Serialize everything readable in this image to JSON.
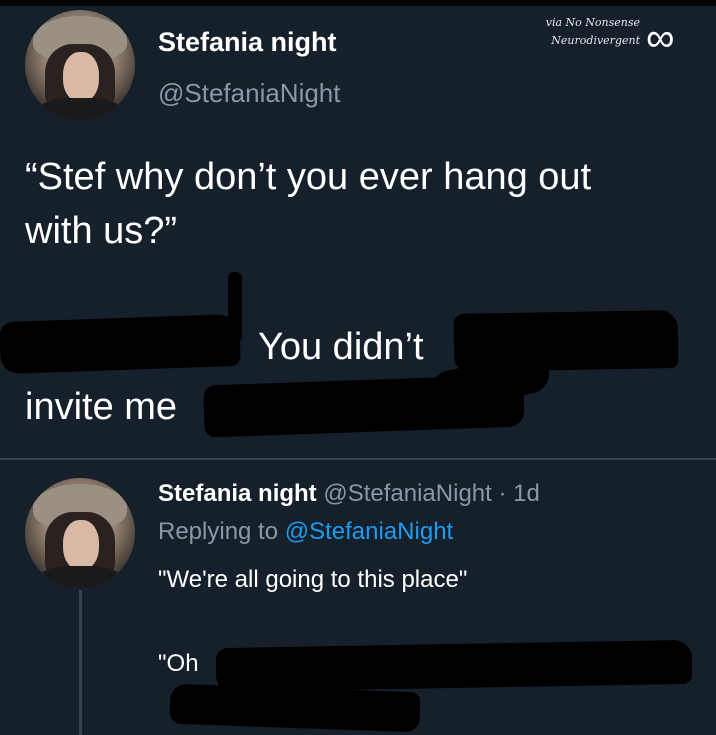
{
  "watermark": {
    "line1": "via No Nonsense",
    "line2": "Neurodivergent",
    "logo_icon": "infinity-icon"
  },
  "tweet": {
    "name": "Stefania night",
    "handle": "@StefaniaNight",
    "line1": "“Stef why don’t you ever hang out",
    "line2": "with us?”",
    "line3": "You didn’t",
    "line4": "invite me"
  },
  "reply": {
    "name": "Stefania night",
    "meta": "@StefaniaNight · 1d",
    "replying_prefix": "Replying to",
    "replying_handle": "@StefaniaNight",
    "line1": "\"We're all going to this place\"",
    "line2": "\"Oh"
  },
  "colors": {
    "background": "#15202b",
    "secondary_text": "#8899a6",
    "link": "#1d9bf0",
    "divider": "#38444d"
  }
}
